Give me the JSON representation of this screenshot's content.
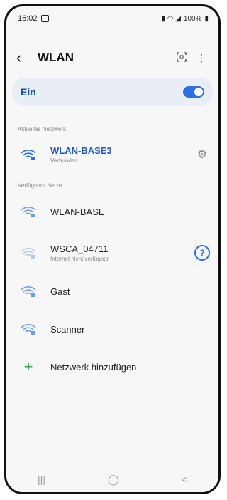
{
  "status_bar": {
    "time": "16:02",
    "battery": "100%"
  },
  "header": {
    "title": "WLAN",
    "back_icon": "back-chevron-icon",
    "scan_icon": "qr-scan-icon",
    "menu_icon": "more-vert-icon"
  },
  "toggle": {
    "label": "Ein",
    "state": "on",
    "accent": "#2b6fe0"
  },
  "current_section": {
    "title": "Aktuelles Netzwerk"
  },
  "current_network": {
    "name": "WLAN-BASE3",
    "status": "Verbunden"
  },
  "available_section": {
    "title": "Verfügbare Netze"
  },
  "networks": [
    {
      "name": "WLAN-BASE",
      "status": ""
    },
    {
      "name": "WSCA_04711",
      "status": "Internet nicht verfügbar"
    },
    {
      "name": "Gast",
      "status": ""
    },
    {
      "name": "Scanner",
      "status": ""
    }
  ],
  "add_network": {
    "label": "Netzwerk hinzufügen"
  },
  "nav": {
    "recent": "|||",
    "home": "◯",
    "back": "<"
  }
}
